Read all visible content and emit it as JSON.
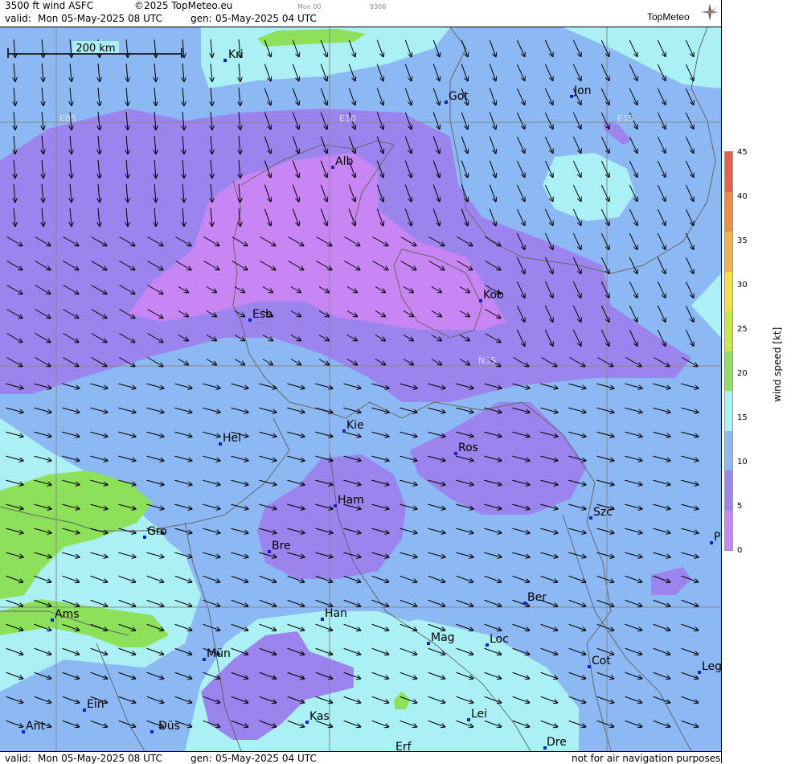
{
  "header": {
    "product": "3500 ft wind ASFC",
    "copyright": "©2025 TopMeteo.eu",
    "run": "Mon 00",
    "code": "9306",
    "valid_label": "valid:",
    "valid": "Mon  05-May-2025  08 UTC",
    "gen_label": "gen:",
    "gen": "05-May-2025 04 UTC",
    "logo": "TopMeteo"
  },
  "footer": {
    "valid_label": "valid:",
    "valid": "Mon  05-May-2025  08 UTC",
    "gen_label": "gen:",
    "gen": "05-May-2025 04 UTC",
    "disclaimer": "not for air navigation purposes"
  },
  "scale_bar": "200 km",
  "grid_labels": [
    "E05",
    "E10",
    "E15",
    "N55"
  ],
  "cities": [
    "Kri",
    "Got",
    "Jon",
    "Alb",
    "Kob",
    "Esb",
    "Kie",
    "Hel",
    "Ros",
    "Ham",
    "Szc",
    "Gro",
    "Bre",
    "P",
    "Ber",
    "Ams",
    "Han",
    "Mag",
    "Loc",
    "Mün",
    "Cot",
    "Leg",
    "Ein",
    "Kas",
    "Lei",
    "Ant",
    "Düs",
    "Dre",
    "Erf"
  ],
  "legend": {
    "title": "wind speed [kt]",
    "ticks": [
      "45",
      "40",
      "35",
      "30",
      "25",
      "20",
      "15",
      "10",
      "5",
      "0"
    ],
    "colors": [
      "#e8604a",
      "#f08c40",
      "#f4b040",
      "#f6e040",
      "#c8e840",
      "#8ce05a",
      "#a8f4f4",
      "#8cb8f4",
      "#9c84ee",
      "#c886f4"
    ]
  },
  "colors": {
    "light_cyan": "#aaf0f4",
    "blue": "#8cb8f4",
    "violet": "#9c84ee",
    "magenta": "#c886f4",
    "green": "#8ce05a",
    "city_marker": "#1420c8"
  }
}
